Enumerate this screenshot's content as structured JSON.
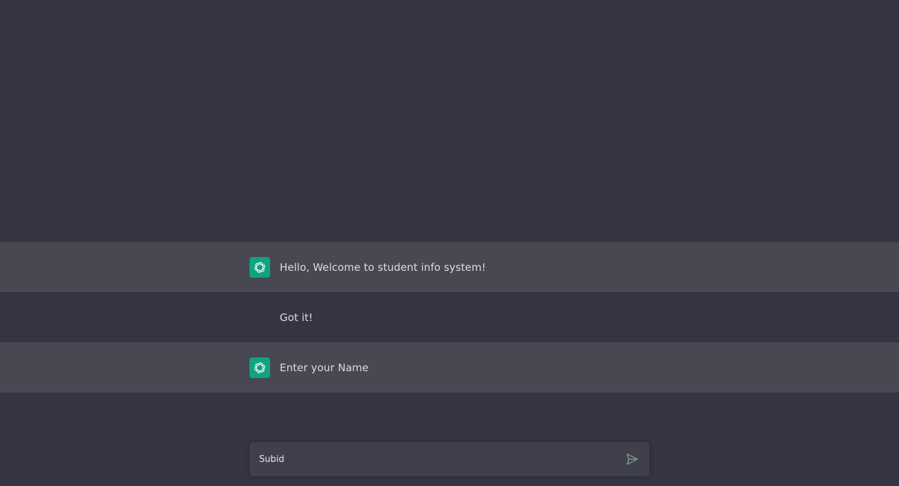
{
  "colors": {
    "background": "#353541",
    "bot_row": "#484852",
    "avatar": "#10a37f",
    "text": "#dcdce2",
    "composer": "#40404c",
    "send_icon": "#7e9a8c"
  },
  "messages": [
    {
      "role": "bot",
      "icon": "openai-logo-icon",
      "text": "Hello, Welcome to student info system!"
    },
    {
      "role": "user",
      "text": "Got it!"
    },
    {
      "role": "bot",
      "icon": "openai-logo-icon",
      "text": "Enter your Name"
    }
  ],
  "composer": {
    "value": "Subid",
    "send_icon": "send-icon"
  }
}
